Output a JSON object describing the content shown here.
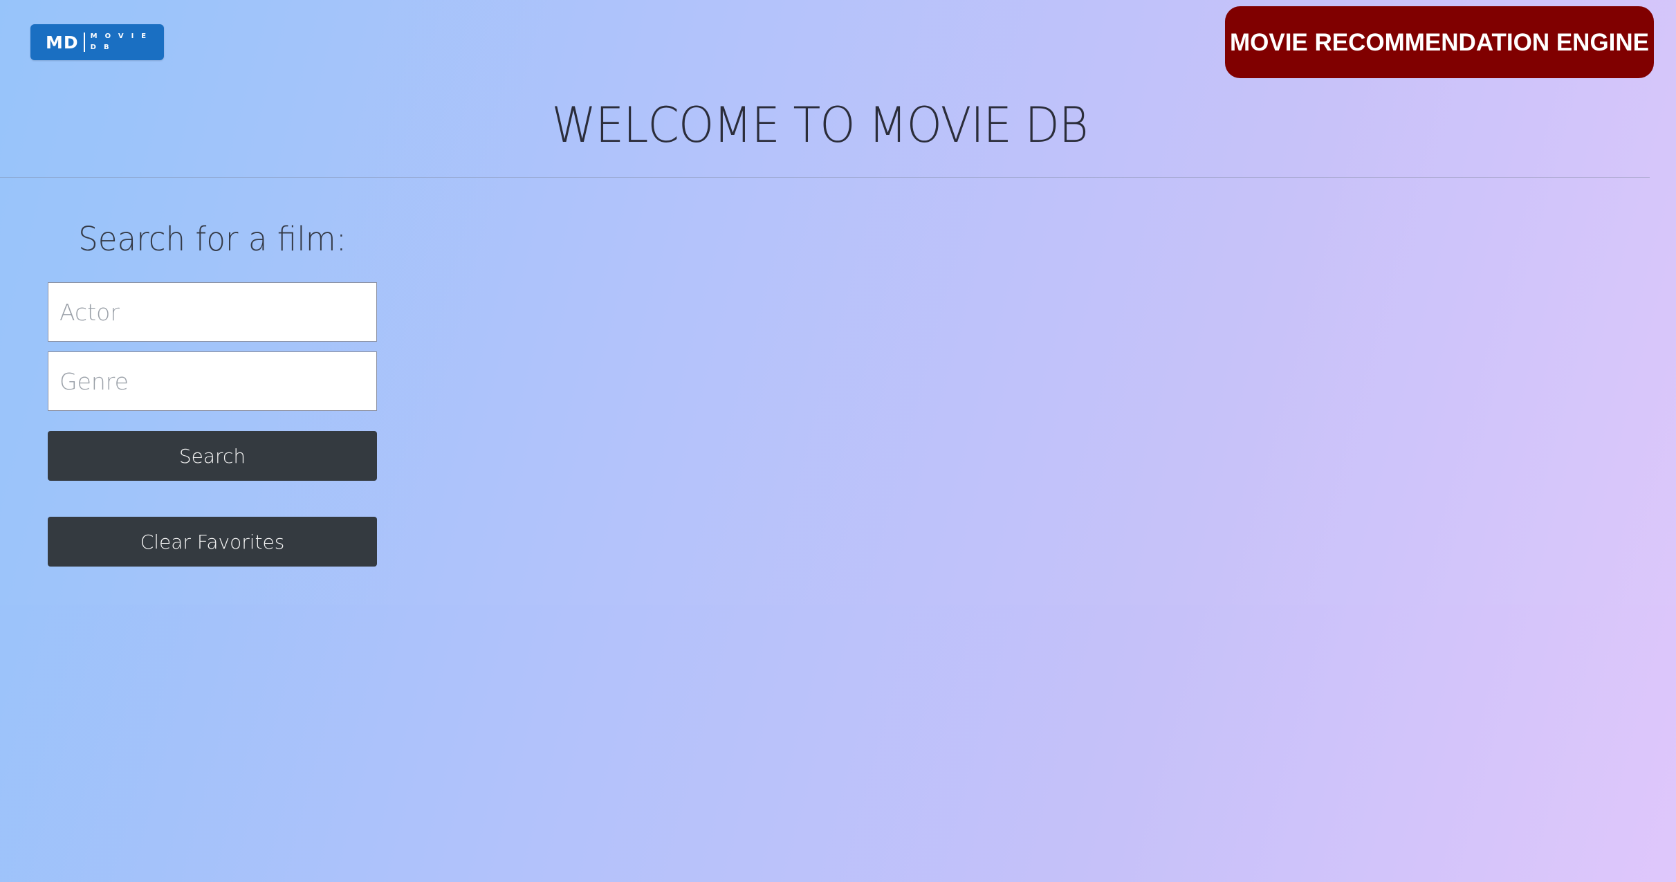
{
  "header": {
    "logo": {
      "main": "MD",
      "sub_line1": "MOVIE",
      "sub_line2": "DB"
    },
    "engine_button_label": "MOVIE RECOMMENDATION ENGINE",
    "engine_button_color": "#800000"
  },
  "main": {
    "title": "WELCOME TO MOVIE DB",
    "search_heading": "Search for a film:",
    "actor_placeholder": "Actor",
    "genre_placeholder": "Genre",
    "search_button_label": "Search",
    "clear_button_label": "Clear Favorites"
  },
  "colors": {
    "button_dark": "#343a40",
    "logo_blue": "#1a6fc2",
    "gradient_start": "#95c3fa",
    "gradient_end": "#dfc7fb"
  }
}
